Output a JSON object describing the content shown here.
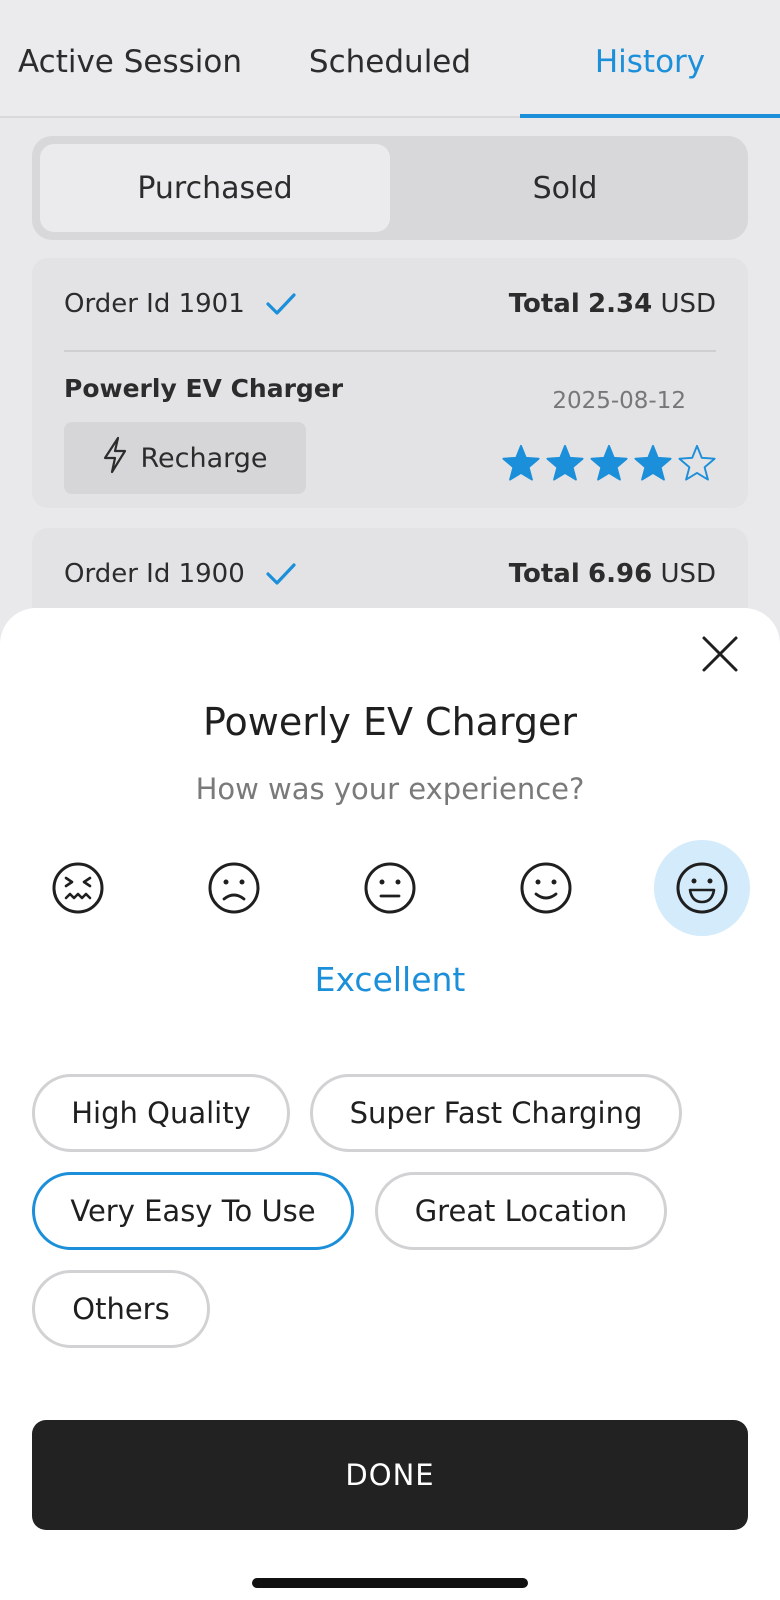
{
  "tabs": [
    {
      "label": "Active Session",
      "active": false
    },
    {
      "label": "Scheduled",
      "active": false
    },
    {
      "label": "History",
      "active": true
    }
  ],
  "segment": {
    "purchased": "Purchased",
    "sold": "Sold",
    "active": "Purchased"
  },
  "orders": [
    {
      "id_label": "Order Id 1901",
      "total_label": "Total",
      "total_value": "2.34",
      "currency": "USD",
      "product": "Powerly EV Charger",
      "date": "2025-08-12",
      "action": "Recharge",
      "rating": 4,
      "rating_max": 5
    },
    {
      "id_label": "Order Id 1900",
      "total_label": "Total",
      "total_value": "6.96",
      "currency": "USD"
    }
  ],
  "sheet": {
    "title": "Powerly EV Charger",
    "subtitle": "How was your experience?",
    "faces": [
      "very-bad-face-icon",
      "bad-face-icon",
      "neutral-face-icon",
      "good-face-icon",
      "excellent-face-icon"
    ],
    "selected_face": 4,
    "rating_label": "Excellent",
    "chips": [
      {
        "label": "High Quality",
        "selected": false
      },
      {
        "label": "Super Fast Charging",
        "selected": false
      },
      {
        "label": "Very Easy To Use",
        "selected": true
      },
      {
        "label": "Great Location",
        "selected": false
      },
      {
        "label": "Others",
        "selected": false
      }
    ],
    "done_label": "DONE"
  },
  "colors": {
    "accent": "#1b8fd9",
    "selected_face_bg": "#d3ebfb",
    "done_bg": "#222222"
  }
}
